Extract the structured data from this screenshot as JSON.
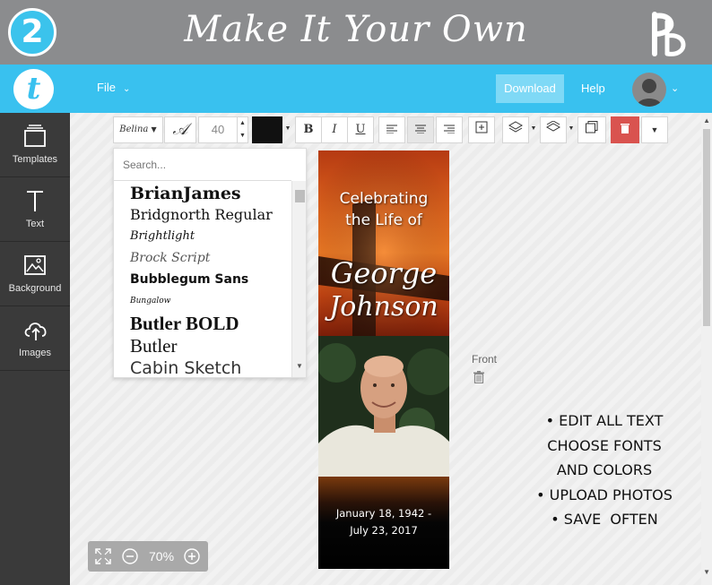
{
  "banner": {
    "step": "2",
    "title": "Make It Your Own",
    "brand_logo_icon": "pb-monogram-logo"
  },
  "topbar": {
    "logo_letter": "t",
    "file_label": "File",
    "download_label": "Download",
    "help_label": "Help"
  },
  "sidebar": {
    "items": [
      {
        "label": "Templates",
        "icon": "templates-icon"
      },
      {
        "label": "Text",
        "icon": "text-icon"
      },
      {
        "label": "Background",
        "icon": "background-icon"
      },
      {
        "label": "Images",
        "icon": "upload-cloud-icon"
      }
    ]
  },
  "toolbar": {
    "font_name": "Belina",
    "font_size": "40",
    "text_color": "#111111",
    "bold": "B",
    "italic": "I",
    "underline": "U"
  },
  "font_dropdown": {
    "placeholder": "Search...",
    "fonts": [
      "BrianJames",
      "Bridgnorth Regular",
      "Brightlight",
      "Brock Script",
      "Bubblegum Sans",
      "Bungalow",
      "Butler BOLD",
      "Butler",
      "Cabin Sketch"
    ]
  },
  "card": {
    "line1": "Celebrating",
    "line2": "the Life of",
    "first_name": "George",
    "last_name": "Johnson",
    "date1": "January 18, 1942 -",
    "date2": "July 23, 2017"
  },
  "side_label": "Front",
  "promo": {
    "lines": [
      "• EDIT ALL TEXT",
      "CHOOSE FONTS",
      "AND COLORS",
      "• UPLOAD PHOTOS",
      "• SAVE  OFTEN"
    ]
  },
  "zoom": {
    "level": "70%"
  },
  "colors": {
    "accent": "#39c1ef",
    "banner": "#8b8c8e",
    "sidebar": "#3a3a3a",
    "delete": "#d9534f"
  }
}
